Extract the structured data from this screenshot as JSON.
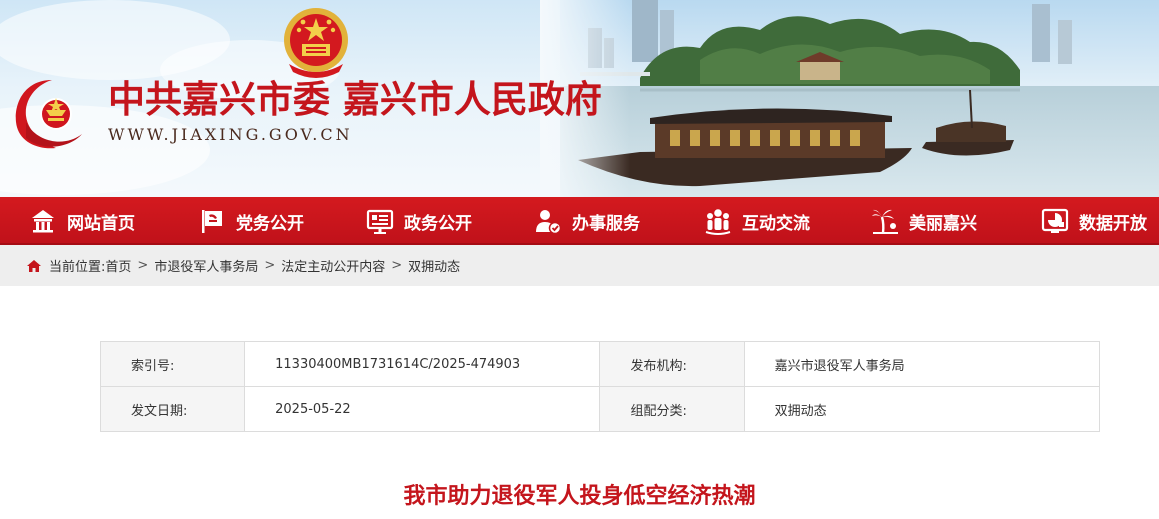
{
  "header": {
    "site_title": "中共嘉兴市委 嘉兴市人民政府",
    "site_url": "WWW.JIAXING.GOV.CN"
  },
  "nav": {
    "items": [
      {
        "label": "网站首页",
        "icon": "home-icon"
      },
      {
        "label": "党务公开",
        "icon": "party-flag-icon"
      },
      {
        "label": "政务公开",
        "icon": "notice-board-icon"
      },
      {
        "label": "办事服务",
        "icon": "service-person-icon"
      },
      {
        "label": "互动交流",
        "icon": "people-group-icon"
      },
      {
        "label": "美丽嘉兴",
        "icon": "palm-tree-icon"
      },
      {
        "label": "数据开放",
        "icon": "data-chart-icon"
      }
    ]
  },
  "breadcrumb": {
    "prefix": "当前位置:",
    "items": [
      "首页",
      "市退役军人事务局",
      "法定主动公开内容",
      "双拥动态"
    ],
    "separator": ">"
  },
  "meta": {
    "index_label": "索引号:",
    "index_value": "11330400MB1731614C/2025-474903",
    "publisher_label": "发布机构:",
    "publisher_value": "嘉兴市退役军人事务局",
    "date_label": "发文日期:",
    "date_value": "2025-05-22",
    "category_label": "组配分类:",
    "category_value": "双拥动态"
  },
  "article": {
    "title": "我市助力退役军人投身低空经济热潮"
  },
  "colors": {
    "brand_red": "#c4151c",
    "nav_red": "#cf161d",
    "crumb_bg": "#eeeeee"
  }
}
